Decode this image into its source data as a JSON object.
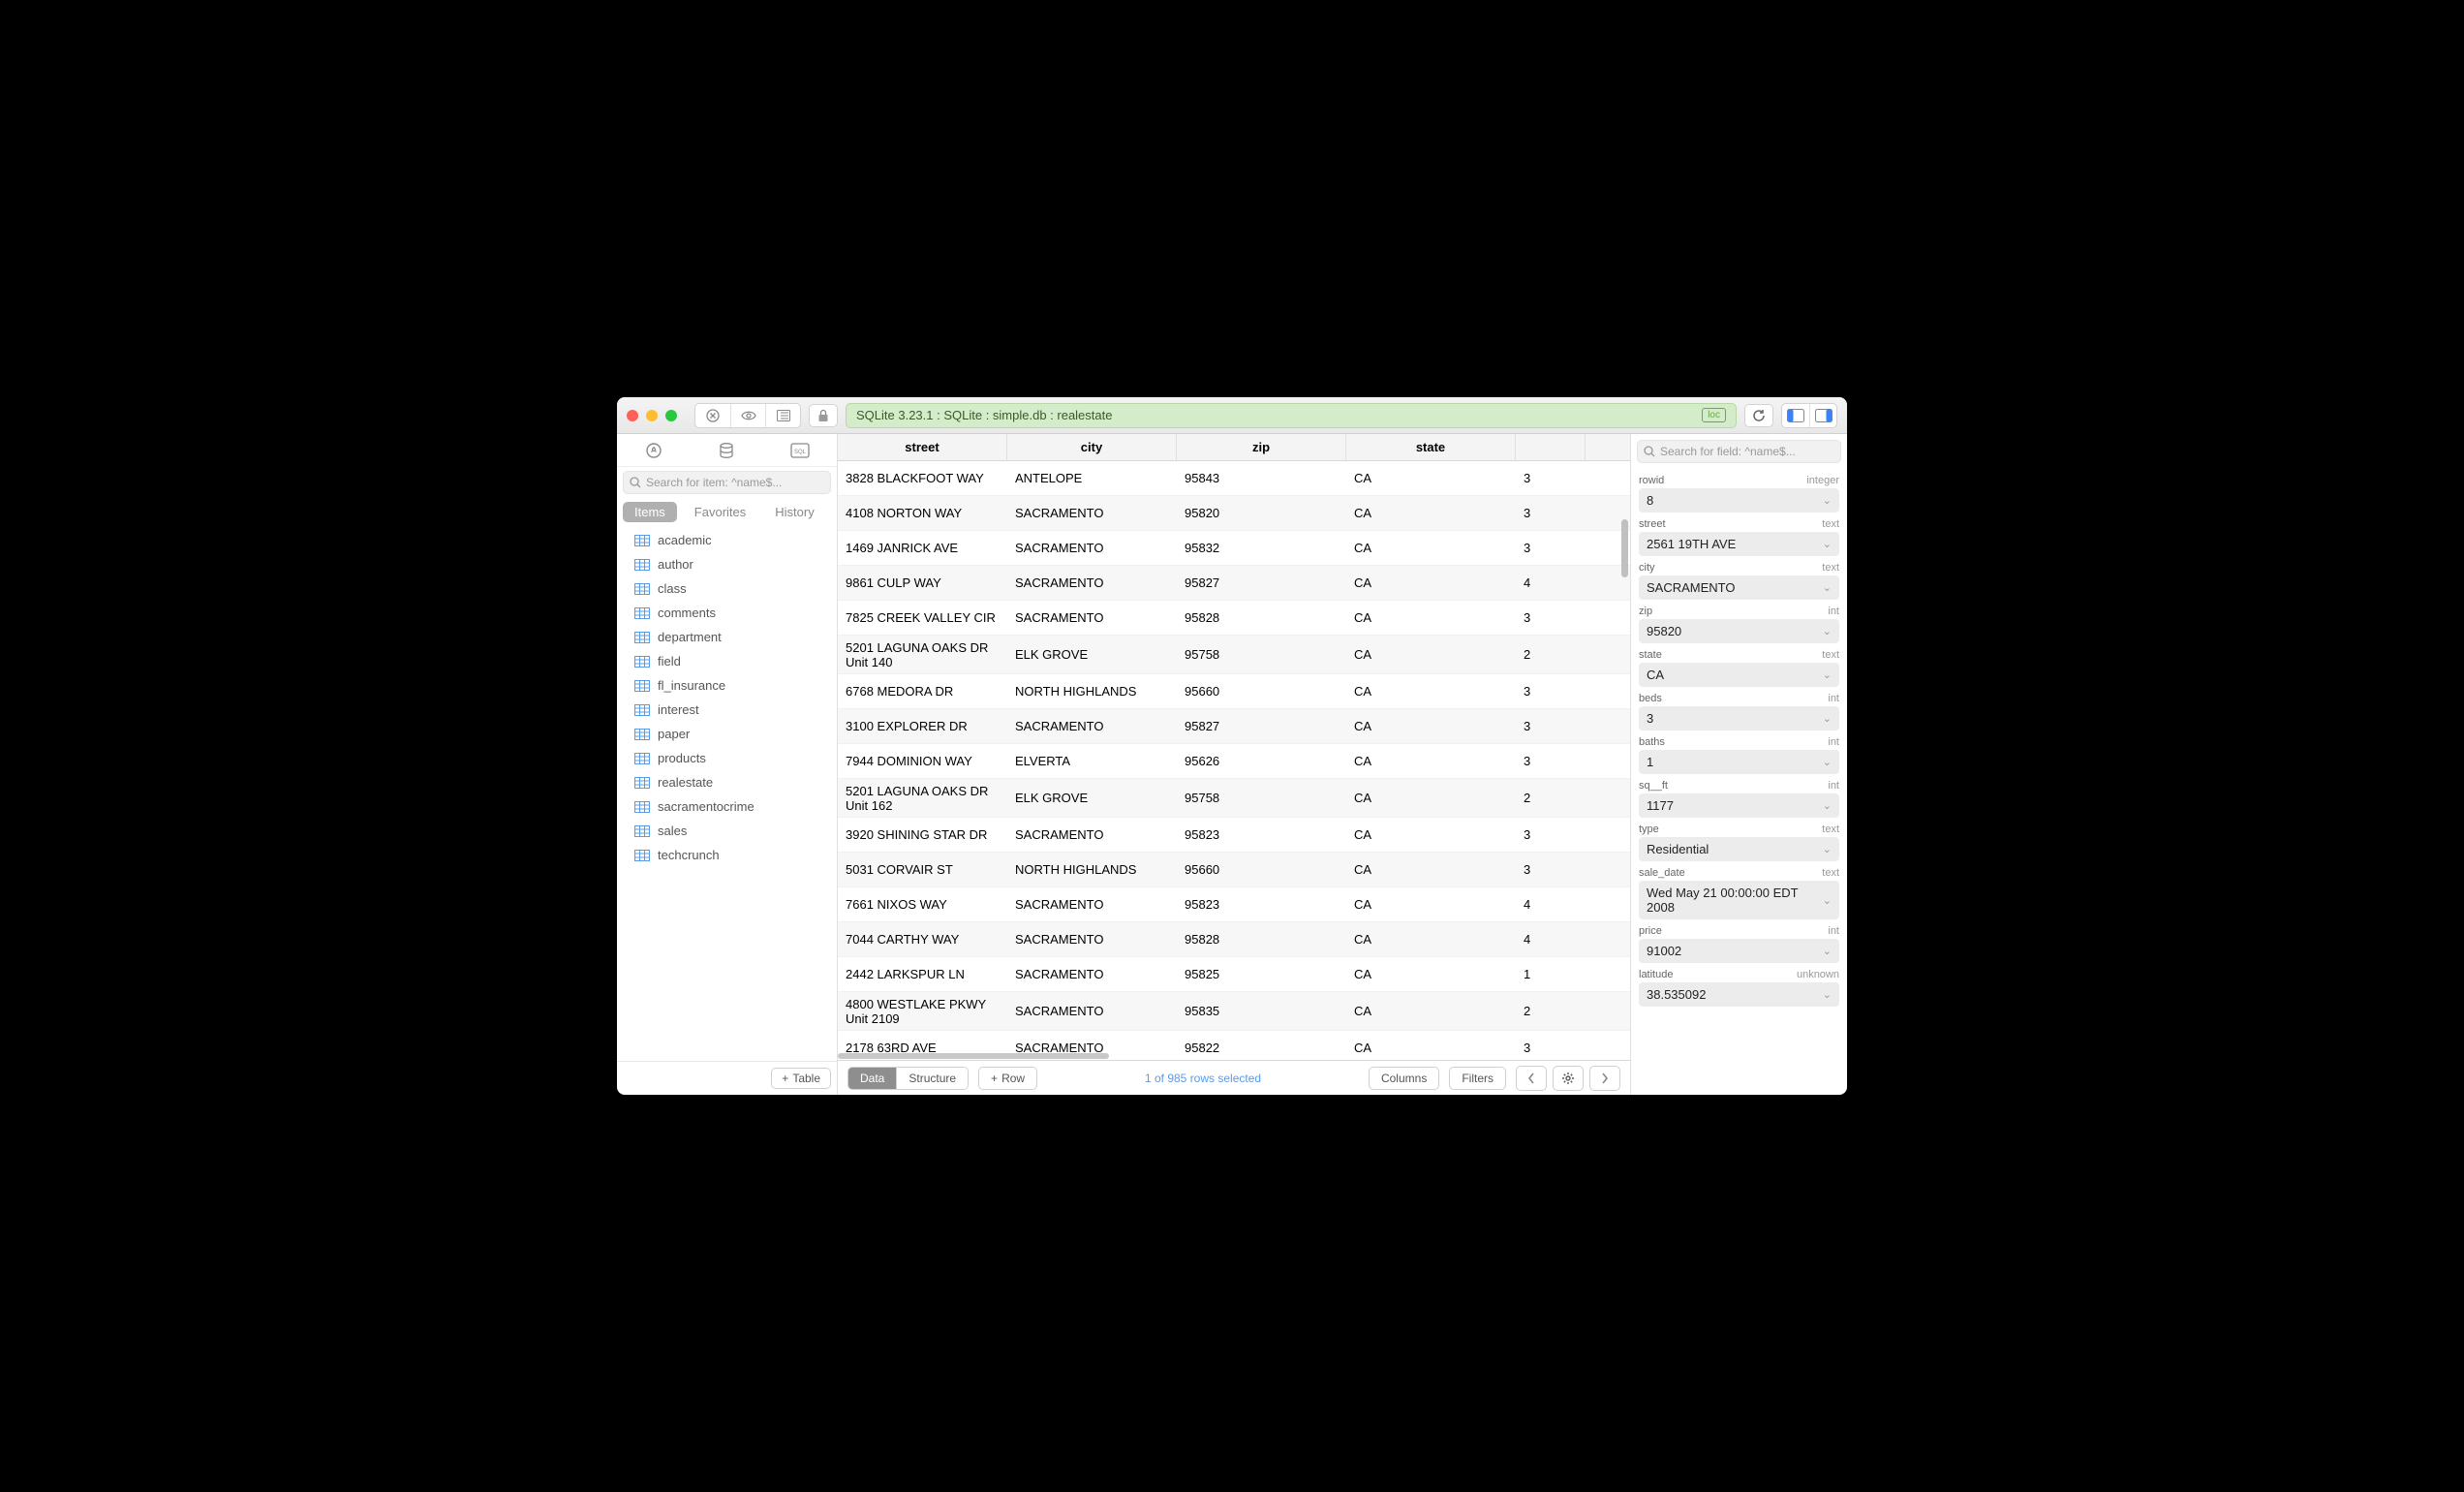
{
  "titlebar": {
    "breadcrumb": "SQLite 3.23.1  :  SQLite  :  simple.db  :  realestate",
    "loc_badge": "loc"
  },
  "sidebar": {
    "search_placeholder": "Search for item: ^name$...",
    "tabs": [
      "Items",
      "Favorites",
      "History"
    ],
    "add_table_label": "Table",
    "items": [
      "academic",
      "author",
      "class",
      "comments",
      "department",
      "field",
      "fl_insurance",
      "interest",
      "paper",
      "products",
      "realestate",
      "sacramentocrime",
      "sales",
      "techcrunch"
    ]
  },
  "table": {
    "columns": [
      "street",
      "city",
      "zip",
      "state",
      ""
    ],
    "rows": [
      {
        "street": "3828 BLACKFOOT WAY",
        "city": "ANTELOPE",
        "zip": "95843",
        "state": "CA",
        "extra": "3"
      },
      {
        "street": "4108 NORTON WAY",
        "city": "SACRAMENTO",
        "zip": "95820",
        "state": "CA",
        "extra": "3"
      },
      {
        "street": "1469 JANRICK AVE",
        "city": "SACRAMENTO",
        "zip": "95832",
        "state": "CA",
        "extra": "3"
      },
      {
        "street": "9861 CULP WAY",
        "city": "SACRAMENTO",
        "zip": "95827",
        "state": "CA",
        "extra": "4"
      },
      {
        "street": "7825 CREEK VALLEY CIR",
        "city": "SACRAMENTO",
        "zip": "95828",
        "state": "CA",
        "extra": "3"
      },
      {
        "street": "5201 LAGUNA OAKS DR",
        "street2": "Unit 140",
        "city": "ELK GROVE",
        "zip": "95758",
        "state": "CA",
        "extra": "2"
      },
      {
        "street": "6768 MEDORA DR",
        "city": "NORTH HIGHLANDS",
        "zip": "95660",
        "state": "CA",
        "extra": "3"
      },
      {
        "street": "3100 EXPLORER DR",
        "city": "SACRAMENTO",
        "zip": "95827",
        "state": "CA",
        "extra": "3"
      },
      {
        "street": "7944 DOMINION WAY",
        "city": "ELVERTA",
        "zip": "95626",
        "state": "CA",
        "extra": "3"
      },
      {
        "street": "5201 LAGUNA OAKS DR",
        "street2": "Unit 162",
        "city": "ELK GROVE",
        "zip": "95758",
        "state": "CA",
        "extra": "2"
      },
      {
        "street": "3920 SHINING STAR DR",
        "city": "SACRAMENTO",
        "zip": "95823",
        "state": "CA",
        "extra": "3"
      },
      {
        "street": "5031 CORVAIR ST",
        "city": "NORTH HIGHLANDS",
        "zip": "95660",
        "state": "CA",
        "extra": "3"
      },
      {
        "street": "7661 NIXOS WAY",
        "city": "SACRAMENTO",
        "zip": "95823",
        "state": "CA",
        "extra": "4"
      },
      {
        "street": "7044 CARTHY WAY",
        "city": "SACRAMENTO",
        "zip": "95828",
        "state": "CA",
        "extra": "4"
      },
      {
        "street": "2442 LARKSPUR LN",
        "city": "SACRAMENTO",
        "zip": "95825",
        "state": "CA",
        "extra": "1"
      },
      {
        "street": "4800 WESTLAKE PKWY",
        "street2": "Unit 2109",
        "city": "SACRAMENTO",
        "zip": "95835",
        "state": "CA",
        "extra": "2"
      },
      {
        "street": "2178 63RD AVE",
        "city": "SACRAMENTO",
        "zip": "95822",
        "state": "CA",
        "extra": "3"
      }
    ]
  },
  "footer": {
    "view_tabs": [
      "Data",
      "Structure"
    ],
    "add_row_label": "Row",
    "status": "1 of 985 rows selected",
    "columns_btn": "Columns",
    "filters_btn": "Filters"
  },
  "detail": {
    "search_placeholder": "Search for field: ^name$...",
    "fields": [
      {
        "label": "rowid",
        "type": "integer",
        "value": "8"
      },
      {
        "label": "street",
        "type": "text",
        "value": "2561 19TH AVE"
      },
      {
        "label": "city",
        "type": "text",
        "value": "SACRAMENTO"
      },
      {
        "label": "zip",
        "type": "int",
        "value": "95820"
      },
      {
        "label": "state",
        "type": "text",
        "value": "CA"
      },
      {
        "label": "beds",
        "type": "int",
        "value": "3"
      },
      {
        "label": "baths",
        "type": "int",
        "value": "1"
      },
      {
        "label": "sq__ft",
        "type": "int",
        "value": "1177"
      },
      {
        "label": "type",
        "type": "text",
        "value": "Residential"
      },
      {
        "label": "sale_date",
        "type": "text",
        "value": "Wed May 21 00:00:00 EDT 2008"
      },
      {
        "label": "price",
        "type": "int",
        "value": "91002"
      },
      {
        "label": "latitude",
        "type": "unknown",
        "value": "38.535092"
      }
    ]
  }
}
